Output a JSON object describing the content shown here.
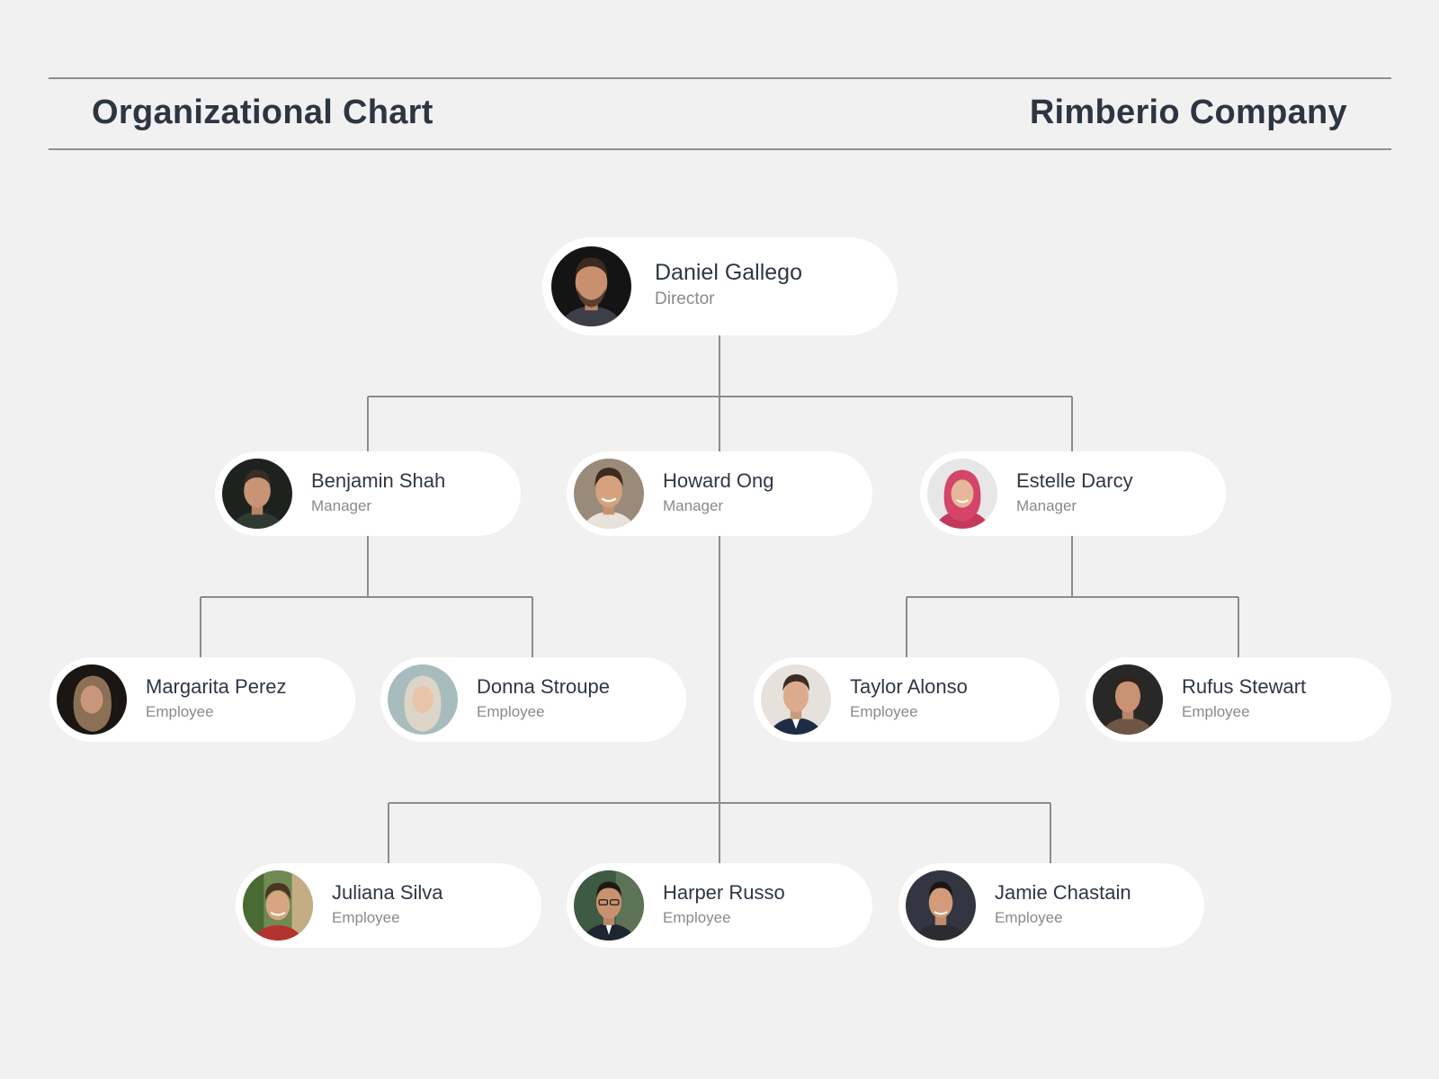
{
  "header": {
    "title": "Organizational Chart",
    "company": "Rimberio Company"
  },
  "colors": {
    "background": "#f1f1f1",
    "card": "#ffffff",
    "name_text": "#2f3744",
    "role_text": "#8a8a8a",
    "connector": "#8c8c8c"
  },
  "people": {
    "director": {
      "name": "Daniel Gallego",
      "role": "Director",
      "avatar": "photo-dark-bg"
    },
    "benjamin": {
      "name": "Benjamin Shah",
      "role": "Manager",
      "avatar": "photo-dark-bg"
    },
    "howard": {
      "name": "Howard Ong",
      "role": "Manager",
      "avatar": "photo-light-bg"
    },
    "estelle": {
      "name": "Estelle Darcy",
      "role": "Manager",
      "avatar": "photo-light-bg-pink-hijab"
    },
    "margarita": {
      "name": "Margarita Perez",
      "role": "Employee",
      "avatar": "photo-dark-bg"
    },
    "donna": {
      "name": "Donna Stroupe",
      "role": "Employee",
      "avatar": "photo-light-bg"
    },
    "taylor": {
      "name": "Taylor Alonso",
      "role": "Employee",
      "avatar": "photo-light-bg"
    },
    "rufus": {
      "name": "Rufus Stewart",
      "role": "Employee",
      "avatar": "photo-dark-bg"
    },
    "juliana": {
      "name": "Juliana Silva",
      "role": "Employee",
      "avatar": "photo-outdoor-bg"
    },
    "harper": {
      "name": "Harper Russo",
      "role": "Employee",
      "avatar": "photo-outdoor-bg"
    },
    "jamie": {
      "name": "Jamie Chastain",
      "role": "Employee",
      "avatar": "photo-dark-bg"
    }
  },
  "hierarchy": {
    "Daniel Gallego": [
      "Benjamin Shah",
      "Howard Ong",
      "Estelle Darcy"
    ],
    "Benjamin Shah": [
      "Margarita Perez",
      "Donna Stroupe"
    ],
    "Howard Ong": [
      "Juliana Silva",
      "Harper Russo",
      "Jamie Chastain"
    ],
    "Estelle Darcy": [
      "Taylor Alonso",
      "Rufus Stewart"
    ]
  }
}
